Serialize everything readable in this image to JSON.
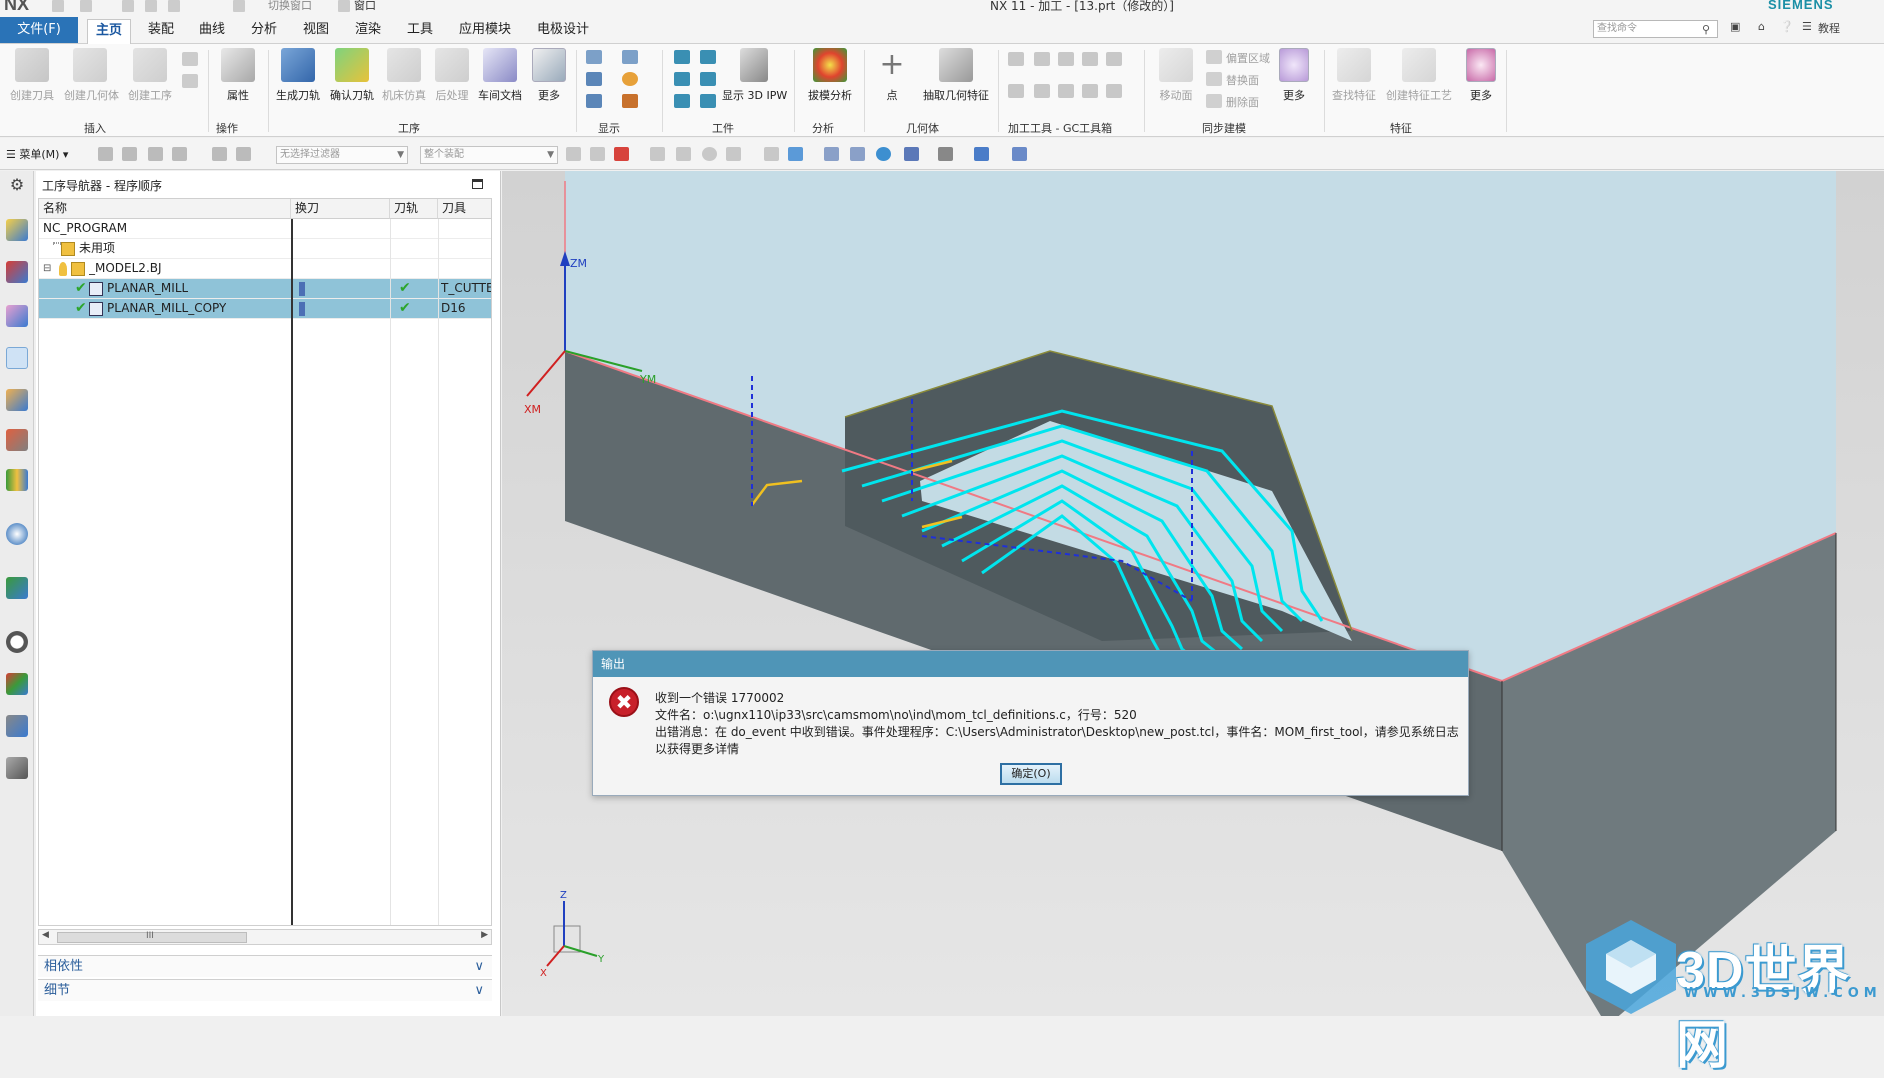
{
  "titlebar": {
    "logo": "NX",
    "title": "NX 11 - 加工 - [13.prt（修改的）]",
    "brand": "SIEMENS",
    "window_label": "切换窗口",
    "window_menu": "窗口"
  },
  "menubar": {
    "file": "文件(F)",
    "tabs": [
      "主页",
      "装配",
      "曲线",
      "分析",
      "视图",
      "渲染",
      "工具",
      "应用模块",
      "电极设计"
    ],
    "active_tab": "主页",
    "search_placeholder": "查找命令",
    "tutorial": "教程"
  },
  "ribbon": {
    "insert": {
      "label": "插入",
      "buttons": [
        "创建刀具",
        "创建几何体",
        "创建工序"
      ]
    },
    "ops": {
      "label": "操作",
      "buttons": [
        "属性"
      ]
    },
    "procedure": {
      "label": "工序",
      "buttons": [
        "生成刀轨",
        "确认刀轨",
        "机床仿真",
        "后处理",
        "车间文档",
        "更多"
      ]
    },
    "display": {
      "label": "显示",
      "buttons": [
        "显示 3D IPW"
      ]
    },
    "workpiece": {
      "label": "工件"
    },
    "analysis": {
      "label": "分析",
      "buttons": [
        "拔模分析"
      ]
    },
    "geometry": {
      "label": "几何体",
      "buttons": [
        "点",
        "抽取几何特征"
      ]
    },
    "gc": {
      "label": "加工工具 - GC工具箱"
    },
    "sync": {
      "label": "同步建模",
      "buttons": [
        "移动面",
        "偏置区域",
        "替换面",
        "删除面",
        "更多"
      ]
    },
    "feature": {
      "label": "特征",
      "buttons": [
        "查找特征",
        "创建特征工艺",
        "更多"
      ]
    }
  },
  "toolbar2": {
    "menu": "菜单(M)",
    "filter": "无选择过滤器",
    "assembly": "整个装配"
  },
  "navigator": {
    "title": "工序导航器 - 程序顺序",
    "columns": [
      "名称",
      "换刀",
      "刀轨",
      "刀具"
    ],
    "rows": [
      {
        "name": "NC_PROGRAM",
        "tool": ""
      },
      {
        "name": "未用项",
        "tool": ""
      },
      {
        "name": "_MODEL2.BJ",
        "tool": ""
      },
      {
        "name": "PLANAR_MILL",
        "tool": "T_CUTTER"
      },
      {
        "name": "PLANAR_MILL_COPY",
        "tool": "D16"
      }
    ],
    "scroll_label": "III",
    "panels": [
      "相依性",
      "细节"
    ]
  },
  "viewport": {
    "axes": {
      "zm": "ZM",
      "ym": "YM",
      "xm": "XM"
    },
    "triad": {
      "z": "Z",
      "y": "Y",
      "x": "X"
    }
  },
  "dialog": {
    "title": "输出",
    "line1": "收到一个错误 1770002",
    "line2": "文件名：o:\\ugnx110\\ip33\\src\\camsmom\\no\\ind\\mom_tcl_definitions.c，行号：520",
    "line3": "出错消息：在 do_event 中收到错误。事件处理程序：C:\\Users\\Administrator\\Desktop\\new_post.tcl，事件名：MOM_first_tool，请参见系统日志",
    "line4": "以获得更多详情",
    "ok": "确定(O)"
  },
  "watermark": {
    "text": "3D世界网",
    "url": "WWW.3DSJW.COM"
  },
  "colors": {
    "accent": "#2a73b7",
    "selection": "#8fc3d8",
    "dialog_title": "#4f95b7",
    "toolpath": "#00e5ee"
  }
}
